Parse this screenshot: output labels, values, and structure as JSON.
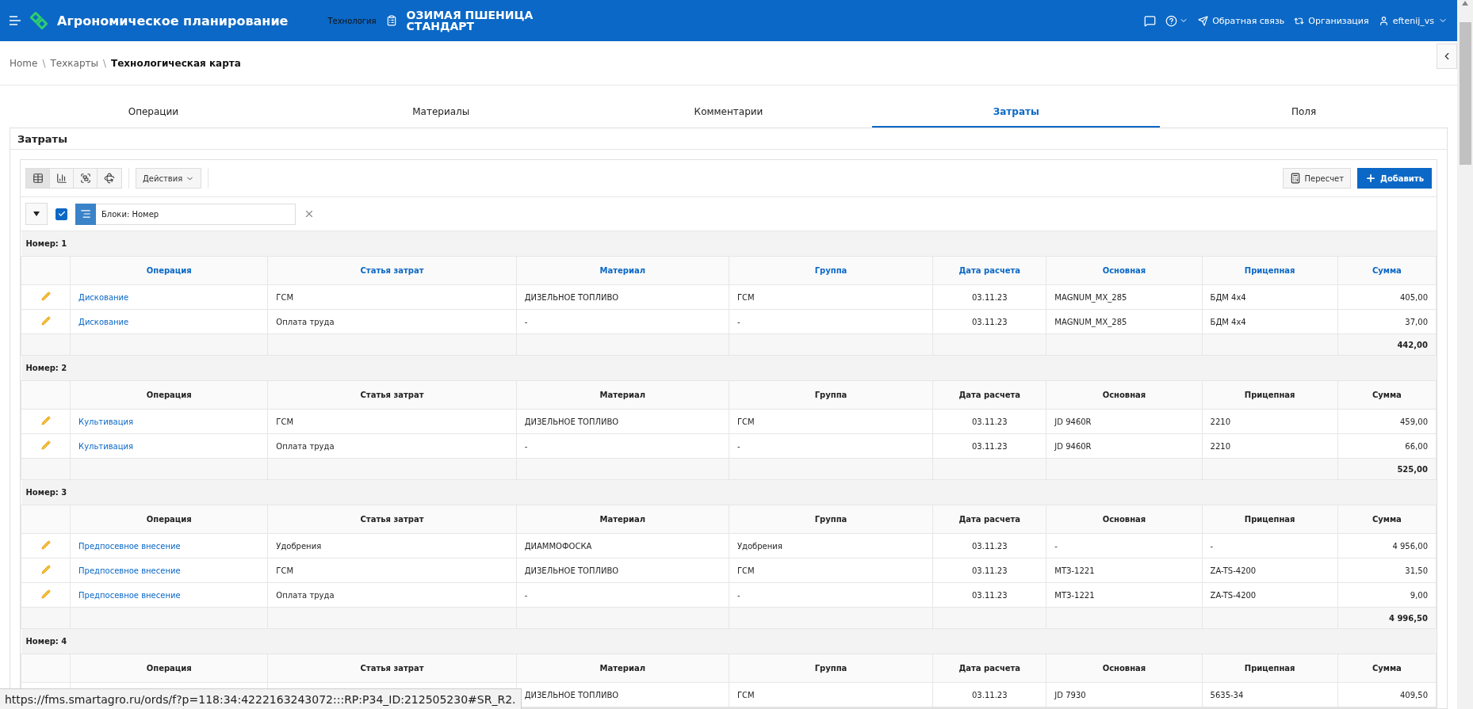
{
  "header": {
    "app_title": "Агрономическое планирование",
    "context_label": "Технология",
    "record_title": [
      "ОЗИМАЯ ПШЕНИЦА",
      "СТАНДАРТ"
    ],
    "feedback": "Обратная связь",
    "organization": "Организация",
    "user": "eftenij_vs"
  },
  "breadcrumb_separator": "\\",
  "breadcrumb": [
    {
      "label": "Home",
      "current": false
    },
    {
      "label": "Техкарты",
      "current": false
    },
    {
      "label": "Технологическая карта",
      "current": true
    }
  ],
  "tabs": [
    {
      "label": "Операции",
      "selected": false
    },
    {
      "label": "Материалы",
      "selected": false
    },
    {
      "label": "Комментарии",
      "selected": false
    },
    {
      "label": "Затраты",
      "selected": true
    },
    {
      "label": "Поля",
      "selected": false
    }
  ],
  "region_title": "Затраты",
  "toolbar": {
    "views": [
      {
        "kind": "table",
        "selected": true
      },
      {
        "kind": "chart",
        "selected": false
      },
      {
        "kind": "group",
        "selected": false
      },
      {
        "kind": "pivot",
        "selected": false
      }
    ],
    "actions": "Действия",
    "recalc": "Пересчет",
    "add": "Добавить"
  },
  "filter": {
    "enabled": true,
    "label": "Блоки: Номер"
  },
  "groups": [
    {
      "label": "Номер: 1",
      "header_links": true,
      "columns": [
        "Операция",
        "Статья затрат",
        "Материал",
        "Группа",
        "Дата расчета",
        "Основная",
        "Прицепная",
        "Сумма"
      ],
      "rows": [
        {
          "editable": true,
          "operation": "Дискование",
          "cost_item": "ГСМ",
          "material": "ДИЗЕЛЬНОЕ ТОПЛИВО",
          "group": "ГСМ",
          "date": "03.11.23",
          "main": "MAGNUM_MX_285",
          "trailer": "БДМ 4х4",
          "sum": "405,00"
        },
        {
          "editable": true,
          "operation": "Дискование",
          "cost_item": "Оплата труда",
          "material": "-",
          "group": "-",
          "date": "03.11.23",
          "main": "MAGNUM_MX_285",
          "trailer": "БДМ 4х4",
          "sum": "37,00"
        }
      ],
      "total": "442,00"
    },
    {
      "label": "Номер: 2",
      "header_links": false,
      "columns": [
        "Операция",
        "Статья затрат",
        "Материал",
        "Группа",
        "Дата расчета",
        "Основная",
        "Прицепная",
        "Сумма"
      ],
      "rows": [
        {
          "editable": true,
          "operation": "Культивация",
          "cost_item": "ГСМ",
          "material": "ДИЗЕЛЬНОЕ ТОПЛИВО",
          "group": "ГСМ",
          "date": "03.11.23",
          "main": "JD 9460R",
          "trailer": "2210",
          "sum": "459,00"
        },
        {
          "editable": true,
          "operation": "Культивация",
          "cost_item": "Оплата труда",
          "material": "-",
          "group": "-",
          "date": "03.11.23",
          "main": "JD 9460R",
          "trailer": "2210",
          "sum": "66,00"
        }
      ],
      "total": "525,00"
    },
    {
      "label": "Номер: 3",
      "header_links": false,
      "columns": [
        "Операция",
        "Статья затрат",
        "Материал",
        "Группа",
        "Дата расчета",
        "Основная",
        "Прицепная",
        "Сумма"
      ],
      "rows": [
        {
          "editable": true,
          "operation": "Предпосевное внесение",
          "cost_item": "Удобрения",
          "material": "ДИАММОФОСКА",
          "group": "Удобрения",
          "date": "03.11.23",
          "main": "-",
          "trailer": "-",
          "sum": "4 956,00"
        },
        {
          "editable": true,
          "operation": "Предпосевное внесение",
          "cost_item": "ГСМ",
          "material": "ДИЗЕЛЬНОЕ ТОПЛИВО",
          "group": "ГСМ",
          "date": "03.11.23",
          "main": "МТЗ-1221",
          "trailer": "ZA-TS-4200",
          "sum": "31,50"
        },
        {
          "editable": true,
          "operation": "Предпосевное внесение",
          "cost_item": "Оплата труда",
          "material": "-",
          "group": "-",
          "date": "03.11.23",
          "main": "МТЗ-1221",
          "trailer": "ZA-TS-4200",
          "sum": "9,00"
        }
      ],
      "total": "4 996,50"
    },
    {
      "label": "Номер: 4",
      "header_links": false,
      "columns": [
        "Операция",
        "Статья затрат",
        "Материал",
        "Группа",
        "Дата расчета",
        "Основная",
        "Прицепная",
        "Сумма"
      ],
      "rows": [
        {
          "material": "ДИЗЕЛЬНОЕ ТОПЛИВО",
          "group": "ГСМ",
          "date": "03.11.23",
          "main": "JD 7930",
          "trailer": "5635-34",
          "sum": "409,50"
        }
      ]
    }
  ],
  "status_url": "https://fms.smartagro.ru/ords/f?p=118:34:4222163243072:::RP:P34_ID:212505230#SR_R2."
}
